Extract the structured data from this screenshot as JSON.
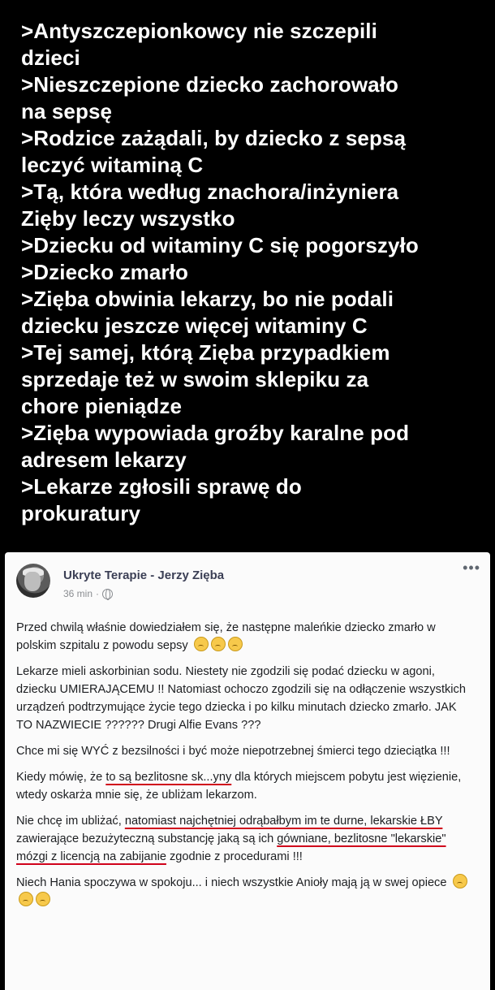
{
  "greentext": [
    ">Antyszczepionkowcy nie szczepili",
    "dzieci",
    ">Nieszczepione dziecko zachorowało",
    "na sepsę",
    ">Rodzice zażądali, by dziecko z sepsą",
    "leczyć witaminą C",
    ">Tą, która według znachora/inżyniera",
    "Zięby leczy wszystko",
    ">Dziecku od witaminy C się pogorszyło",
    ">Dziecko zmarło",
    ">Zięba obwinia lekarzy, bo nie podali",
    "dziecku jeszcze więcej witaminy C",
    ">Tej samej, którą Zięba przypadkiem",
    "sprzedaje też w swoim sklepiku za",
    "chore pieniądze",
    ">Zięba wypowiada groźby karalne pod",
    "adresem lekarzy",
    ">Lekarze zgłosili sprawę do",
    "prokuratury"
  ],
  "post": {
    "author": "Ukryte Terapie - Jerzy Zięba",
    "time": "36 min",
    "separator": "·",
    "more": "•••",
    "paragraphs": {
      "p1": "Przed chwilą właśnie dowiedziałem się, że następne maleńkie dziecko zmarło w polskim szpitalu z powodu sepsy",
      "p2": "Lekarze mieli askorbinian sodu. Niestety nie zgodzili się podać dziecku w agoni, dziecku UMIERAJĄCEMU !! Natomiast ochoczo zgodzili się na odłączenie wszystkich urządzeń podtrzymujące życie tego dziecka i po kilku minutach dziecko zmarło. JAK TO NAZWIECIE ?????? Drugi Alfie Evans ???",
      "p3": "Chce mi się WYĆ z bezsilności i być może niepotrzebnej śmierci tego dzieciątka !!!",
      "p4a": "Kiedy mówię, że ",
      "p4b": "to są bezlitosne sk...yny",
      "p4c": " dla których miejscem pobytu jest więzienie, wtedy oskarża mnie się, że ubliżam lekarzom.",
      "p5a": "Nie chcę im ubliżać, ",
      "p5b": "natomiast najchętniej odrąbałbym im te durne, lekarskie ŁBY",
      "p5c": " zawierające bezużyteczną substancję jaką są ich ",
      "p5d": "gówniane, bezlitosne \"lekarskie\" mózgi z licencją na zabijanie",
      "p5e": " zgodnie z procedurami !!!",
      "p6": "Niech Hania spoczywa w spokoju... i niech wszystkie Anioły mają ją w swej opiece"
    }
  },
  "colors": {
    "underline": "#d0021b",
    "author": "#3b3f55",
    "meta": "#8a8d91"
  }
}
